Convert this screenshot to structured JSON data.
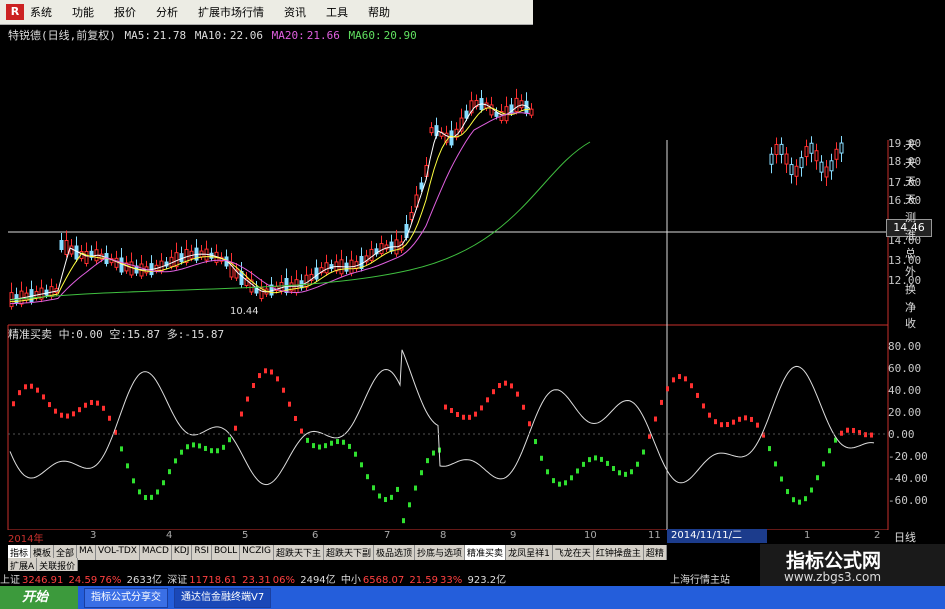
{
  "menu": [
    "系统",
    "功能",
    "报价",
    "分析",
    "扩展市场行情",
    "资讯",
    "工具",
    "帮助"
  ],
  "chart_header": {
    "stock_name": "特锐德(日线,前复权)",
    "ma5_label": "MA5:",
    "ma5": "21.78",
    "ma10_label": "MA10:",
    "ma10": "22.06",
    "ma20_label": "MA20:",
    "ma20": "21.66",
    "ma60_label": "MA60:",
    "ma60": "20.90"
  },
  "osc_header": {
    "name": "精准买卖",
    "mid_label": "中:",
    "mid": "0.00",
    "short_label": "空:",
    "short": "15.87",
    "long_label": "多:",
    "long": "-15.87"
  },
  "price_axis": [
    "19.00",
    "18.00",
    "17.00",
    "16.00",
    "14.00",
    "13.00",
    "12.00"
  ],
  "current_price": "14.46",
  "low_marker": "10.44",
  "osc_axis": [
    "80.00",
    "60.00",
    "40.00",
    "20.00",
    "0.00",
    "-20.00",
    "-40.00",
    "-60.00"
  ],
  "side_labels": [
    "天",
    "天",
    "天",
    "天",
    "测",
    "淮",
    "总",
    "外",
    "换",
    "净",
    "收"
  ],
  "date_axis": [
    "2014年",
    "3",
    "4",
    "5",
    "6",
    "7",
    "8",
    "9",
    "10",
    "11",
    "1",
    "2"
  ],
  "date_selected": "2014/11/11/二",
  "period_label": "日线",
  "tabs": [
    "指标",
    "模板",
    "全部",
    "MA",
    "VOL-TDX",
    "MACD",
    "KDJ",
    "RSI",
    "BOLL",
    "NCZIG",
    "超跌天下主",
    "超跌天下副",
    "极品选顶",
    "抄底与选项",
    "精准买卖",
    "龙凤呈祥1",
    "飞龙在天",
    "红钟操盘主",
    "超精"
  ],
  "tabs2": [
    "扩展A",
    "关联报价"
  ],
  "ticker": [
    {
      "label": "上证",
      "val": "3246.91",
      "chg": "24.59",
      "pct": "76%",
      "vol": "2633亿"
    },
    {
      "label": "深证",
      "val": "11718.61",
      "chg": "23.31",
      "pct": "06%",
      "vol": "2494亿"
    },
    {
      "label": "中小",
      "val": "6568.07",
      "chg": "21.59",
      "pct": "33%",
      "vol": "923.2亿"
    }
  ],
  "ticker_right": "上海行情主站",
  "taskbar": {
    "start": "开始",
    "tasks": [
      "指标公式分享交",
      "通达信金融终端V7"
    ]
  },
  "watermark": {
    "title": "指标公式网",
    "url": "www.zbgs3.com"
  },
  "colors": {
    "up": "#ff3030",
    "down": "#30e030",
    "axis": "#c8302c",
    "ma5": "#ffffff",
    "ma10": "#ffff40",
    "ma20": "#e060e0",
    "ma60": "#40c040"
  }
}
